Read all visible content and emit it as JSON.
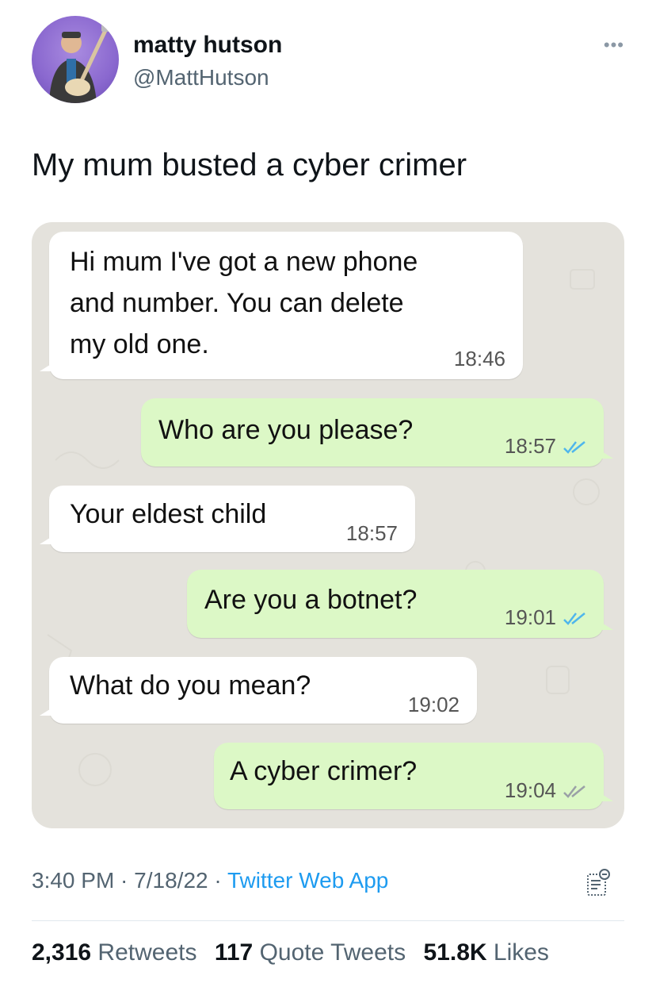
{
  "author": {
    "name": "matty hutson",
    "handle": "@MattHutson",
    "more_icon": "more-dots-icon"
  },
  "tweet": {
    "text": "My mum busted a cyber crimer"
  },
  "chat": {
    "messages": [
      {
        "direction": "incoming",
        "text": "Hi mum I've got a new phone\nand number. You can delete\nmy old one.",
        "time": "18:46"
      },
      {
        "direction": "outgoing",
        "text": "Who are you please?",
        "time": "18:57",
        "read": true
      },
      {
        "direction": "incoming",
        "text": "Your eldest child",
        "time": "18:57"
      },
      {
        "direction": "outgoing",
        "text": "Are you a botnet?",
        "time": "19:01",
        "read": true
      },
      {
        "direction": "incoming",
        "text": "What do you mean?",
        "time": "19:02"
      },
      {
        "direction": "outgoing",
        "text": "A cyber crimer?",
        "time": "19:04",
        "read": false
      }
    ],
    "colors": {
      "incoming": "#ffffff",
      "outgoing": "#dcf8c6",
      "read_tick": "#4fb6ec",
      "unread_tick": "#9aa0a6",
      "background": "#e4e2dc"
    }
  },
  "meta": {
    "time": "3:40 PM",
    "sep1": " · ",
    "date": "7/18/22",
    "sep2": " · ",
    "source": "Twitter Web App",
    "analytics_icon": "analytics-icon"
  },
  "stats": {
    "retweets_count": "2,316",
    "retweets_label": "Retweets",
    "quotes_count": "117",
    "quotes_label": "Quote Tweets",
    "likes_count": "51.8K",
    "likes_label": "Likes"
  }
}
